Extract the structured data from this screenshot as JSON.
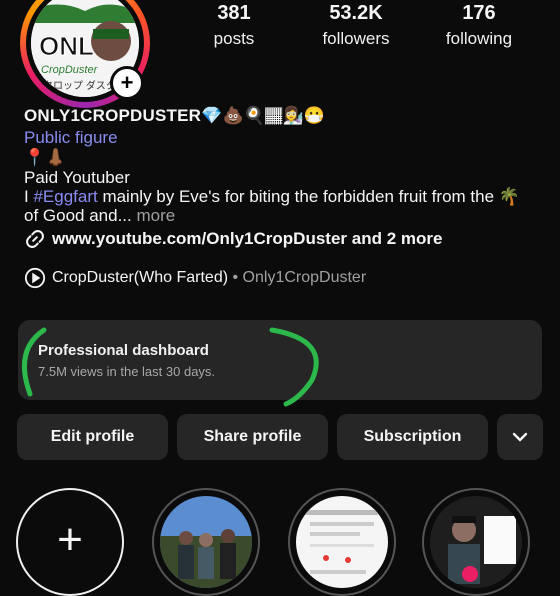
{
  "profile": {
    "username": "ONLY1CROPDUSTER",
    "username_emojis": "💎💩🍳🏾👩‍🔬😷",
    "category": "Public figure",
    "pin_line": "📍👃🏾",
    "bio_line1": "Paid Youtuber",
    "bio_line2_prefix": "I ",
    "bio_hashtag": "#Eggfart",
    "bio_line2_suffix": " mainly by Eve's for biting the forbidden fruit from the 🌴",
    "bio_line3": "of Good and...",
    "bio_more": " more",
    "link_text": "www.youtube.com/Only1CropDuster and 2 more",
    "channel_name": "CropDuster(Who Farted)",
    "channel_sub": " • Only1CropDuster"
  },
  "stats": {
    "posts_count": "381",
    "posts_label": "posts",
    "followers_count": "53.2K",
    "followers_label": "followers",
    "following_count": "176",
    "following_label": "following"
  },
  "dashboard": {
    "title": "Professional dashboard",
    "subtitle": "7.5M views in the last 30 days."
  },
  "buttons": {
    "edit": "Edit profile",
    "share": "Share profile",
    "subscription": "Subscription"
  },
  "avatar": {
    "logo_text": "ONLY1",
    "logo_sub": "CropDuster"
  },
  "colors": {
    "accent": "#8a8cf2",
    "background": "#0b0b0b",
    "surface": "#262626",
    "annotation": "#2db84b"
  }
}
